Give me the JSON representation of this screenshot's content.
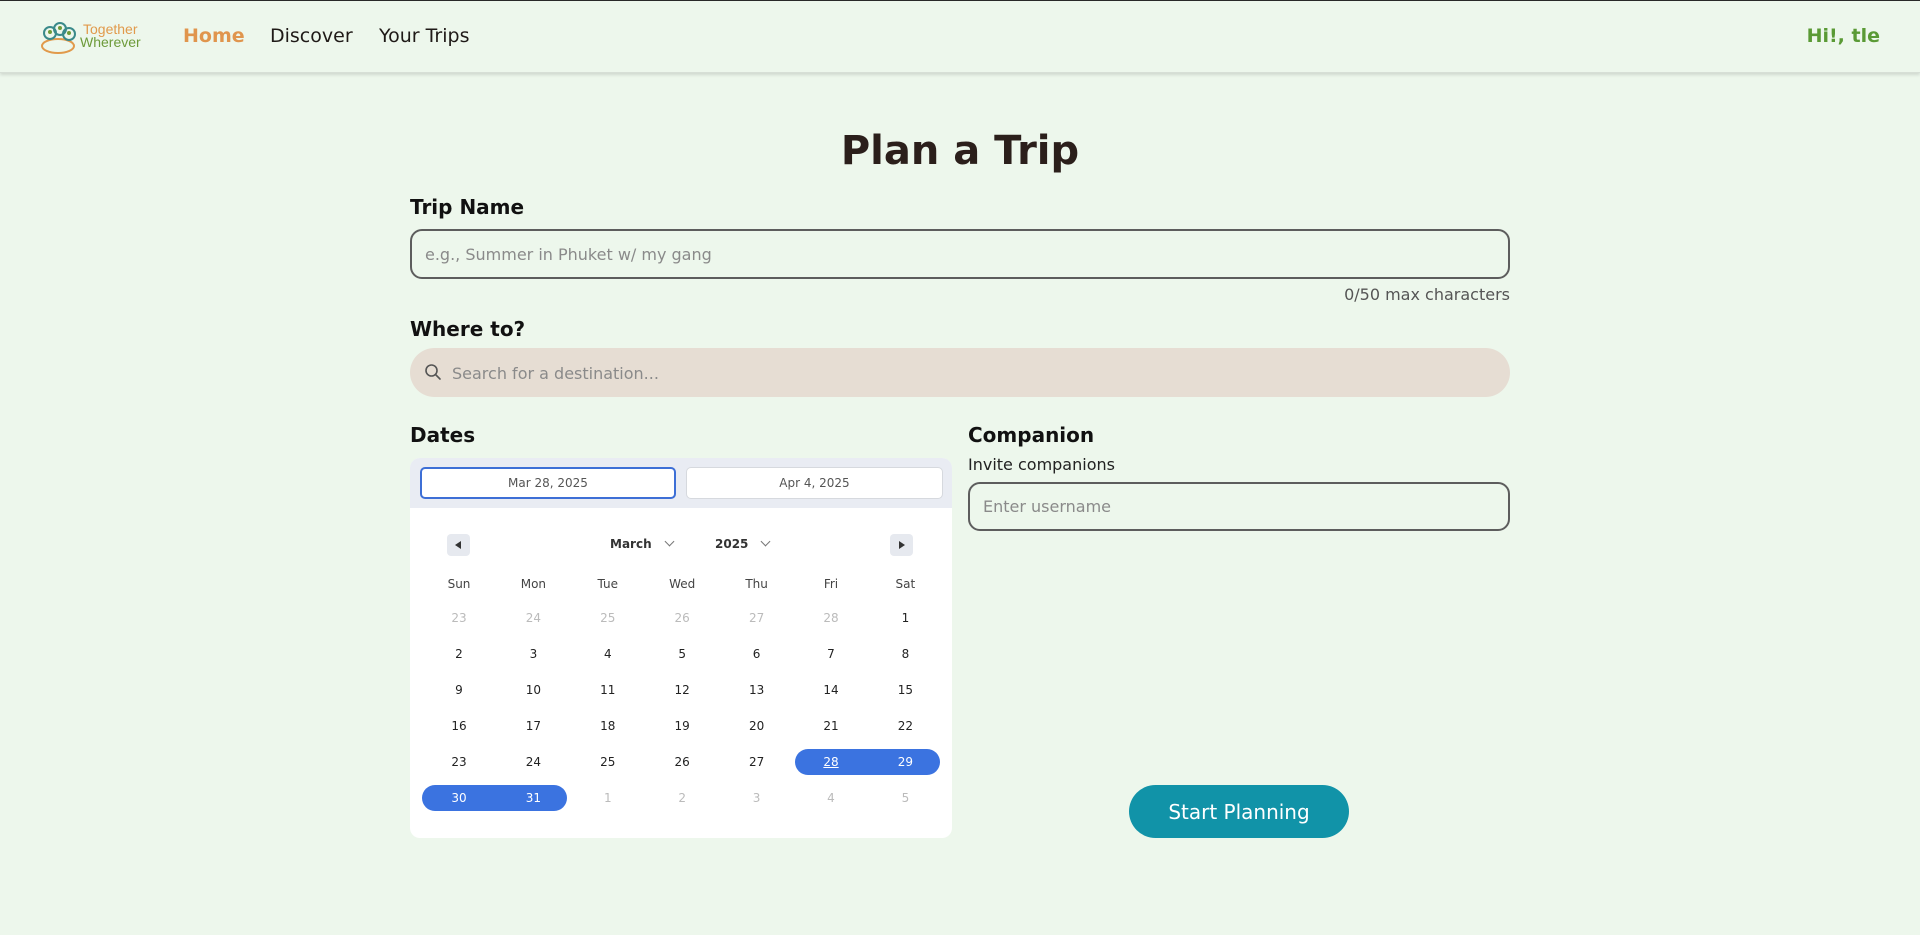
{
  "nav": {
    "logo_line1": "Together",
    "logo_line2": "Wherever",
    "home": "Home",
    "discover": "Discover",
    "your_trips": "Your Trips",
    "greeting": "Hi!, tle"
  },
  "page": {
    "title": "Plan a Trip"
  },
  "trip_name": {
    "label": "Trip Name",
    "placeholder": "e.g., Summer in Phuket w/ my gang",
    "counter": "0/50 max characters"
  },
  "where": {
    "label": "Where to?",
    "placeholder": "Search for a destination..."
  },
  "dates": {
    "label": "Dates",
    "start": "Mar 28, 2025",
    "end": "Apr 4, 2025",
    "month": "March",
    "year": "2025",
    "weekdays": [
      "Sun",
      "Mon",
      "Tue",
      "Wed",
      "Thu",
      "Fri",
      "Sat"
    ],
    "weeks": [
      [
        "23",
        "24",
        "25",
        "26",
        "27",
        "28",
        "1"
      ],
      [
        "2",
        "3",
        "4",
        "5",
        "6",
        "7",
        "8"
      ],
      [
        "9",
        "10",
        "11",
        "12",
        "13",
        "14",
        "15"
      ],
      [
        "16",
        "17",
        "18",
        "19",
        "20",
        "21",
        "22"
      ],
      [
        "23",
        "24",
        "25",
        "26",
        "27",
        "28",
        "29"
      ],
      [
        "30",
        "31",
        "1",
        "2",
        "3",
        "4",
        "5"
      ]
    ]
  },
  "companion": {
    "label": "Companion",
    "sublabel": "Invite companions",
    "placeholder": "Enter username"
  },
  "actions": {
    "start_planning": "Start Planning"
  },
  "colors": {
    "background": "#edf7ec",
    "nav_active": "#e0954d",
    "greeting": "#5a9a35",
    "selected_range": "#3b73e0",
    "primary_button": "#1193a8",
    "search_bg": "#e6ddd3"
  }
}
